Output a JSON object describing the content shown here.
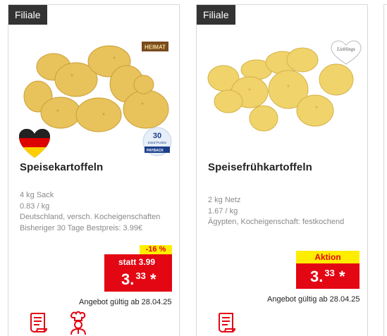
{
  "cards": [
    {
      "badge": "Filiale",
      "title": "Speisekartoffeln",
      "details": [
        "4 kg Sack",
        "0.83 / kg",
        "Deutschland, versch. Kocheigenschaften",
        "Bisheriger 30 Tage Bestpreis: 3.99€"
      ],
      "logo_text": "HEIMAT",
      "payback_points": "30",
      "payback_line": "Extra°Punkte",
      "payback_brand": "PAYBACK",
      "discount": "-16 %",
      "old_price": "statt 3.99",
      "price_main": "3.",
      "price_cents": "33",
      "price_star": "*",
      "valid": "Angebot gültig ab 28.04.25",
      "icons": [
        "recipe-icon",
        "chef-icon"
      ]
    },
    {
      "badge": "Filiale",
      "title": "Speisefrühkartoffeln",
      "details": [
        "2 kg Netz",
        "1.67 / kg",
        "Ägypten, Kocheigenschaft: festkochend"
      ],
      "logo_text": "Lieblings",
      "promo": "Aktion",
      "price_main": "3.",
      "price_cents": "33",
      "price_star": "*",
      "valid": "Angebot gültig ab 28.04.25",
      "icons": [
        "recipe-icon"
      ]
    }
  ],
  "colors": {
    "red": "#e30613",
    "yellow": "#ffed00",
    "badge": "#333333"
  }
}
